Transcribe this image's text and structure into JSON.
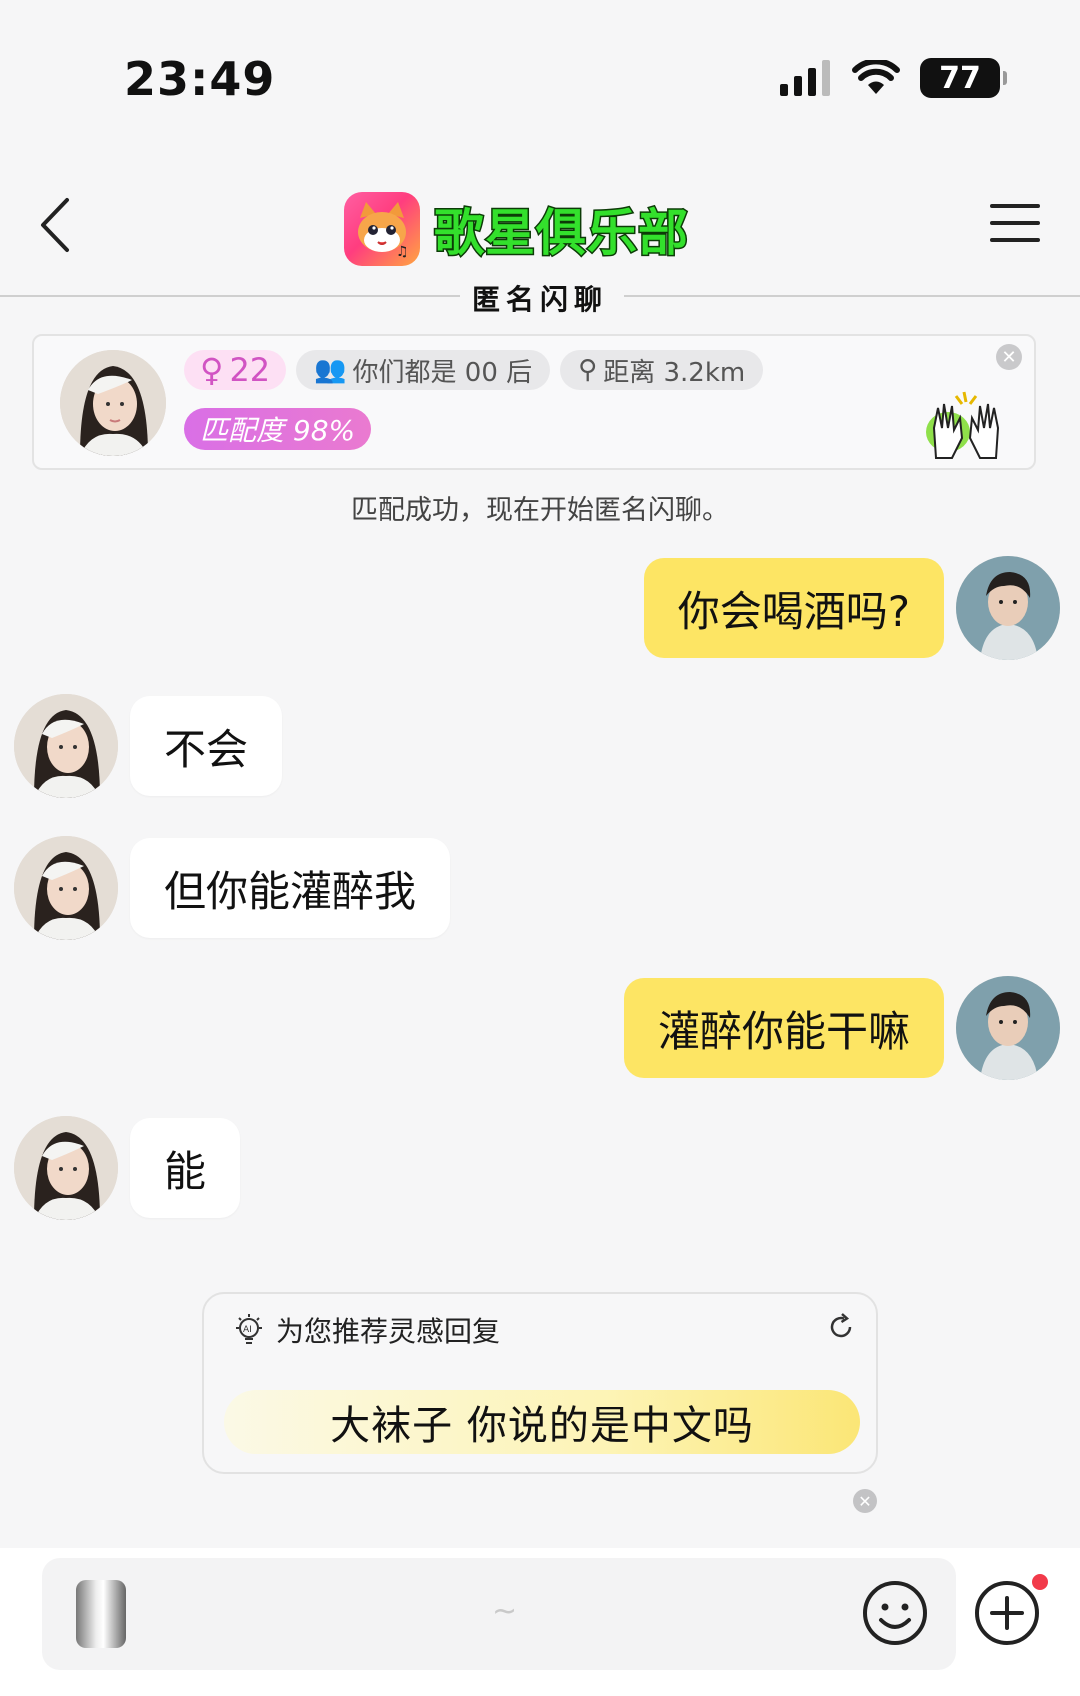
{
  "status_bar": {
    "time": "23:49",
    "battery": "77"
  },
  "header": {
    "app_name": "歌星俱乐部",
    "subtitle": "匿名闪聊",
    "back_icon": "chevron-left-icon",
    "menu_icon": "hamburger-menu-icon"
  },
  "match_card": {
    "age": "22",
    "tag_generation": "你们都是 00 后",
    "tag_distance": "距离 3.2km",
    "match_rate": "匹配度 98%"
  },
  "system_message": "匹配成功，现在开始匿名闪聊。",
  "messages": [
    {
      "side": "out",
      "text": "你会喝酒吗?"
    },
    {
      "side": "in",
      "text": "不会"
    },
    {
      "side": "in",
      "text": "但你能灌醉我"
    },
    {
      "side": "out",
      "text": "灌醉你能干嘛"
    },
    {
      "side": "in",
      "text": "能"
    }
  ],
  "suggestion": {
    "header": "为您推荐灵感回复",
    "reply": "大袜子  你说的是中文吗"
  },
  "composer": {
    "placeholder": "~"
  },
  "colors": {
    "out_bubble": "#fde564",
    "in_bubble": "#ffffff",
    "brand_green": "#33e02c",
    "match_pink": "#d96fe6"
  }
}
